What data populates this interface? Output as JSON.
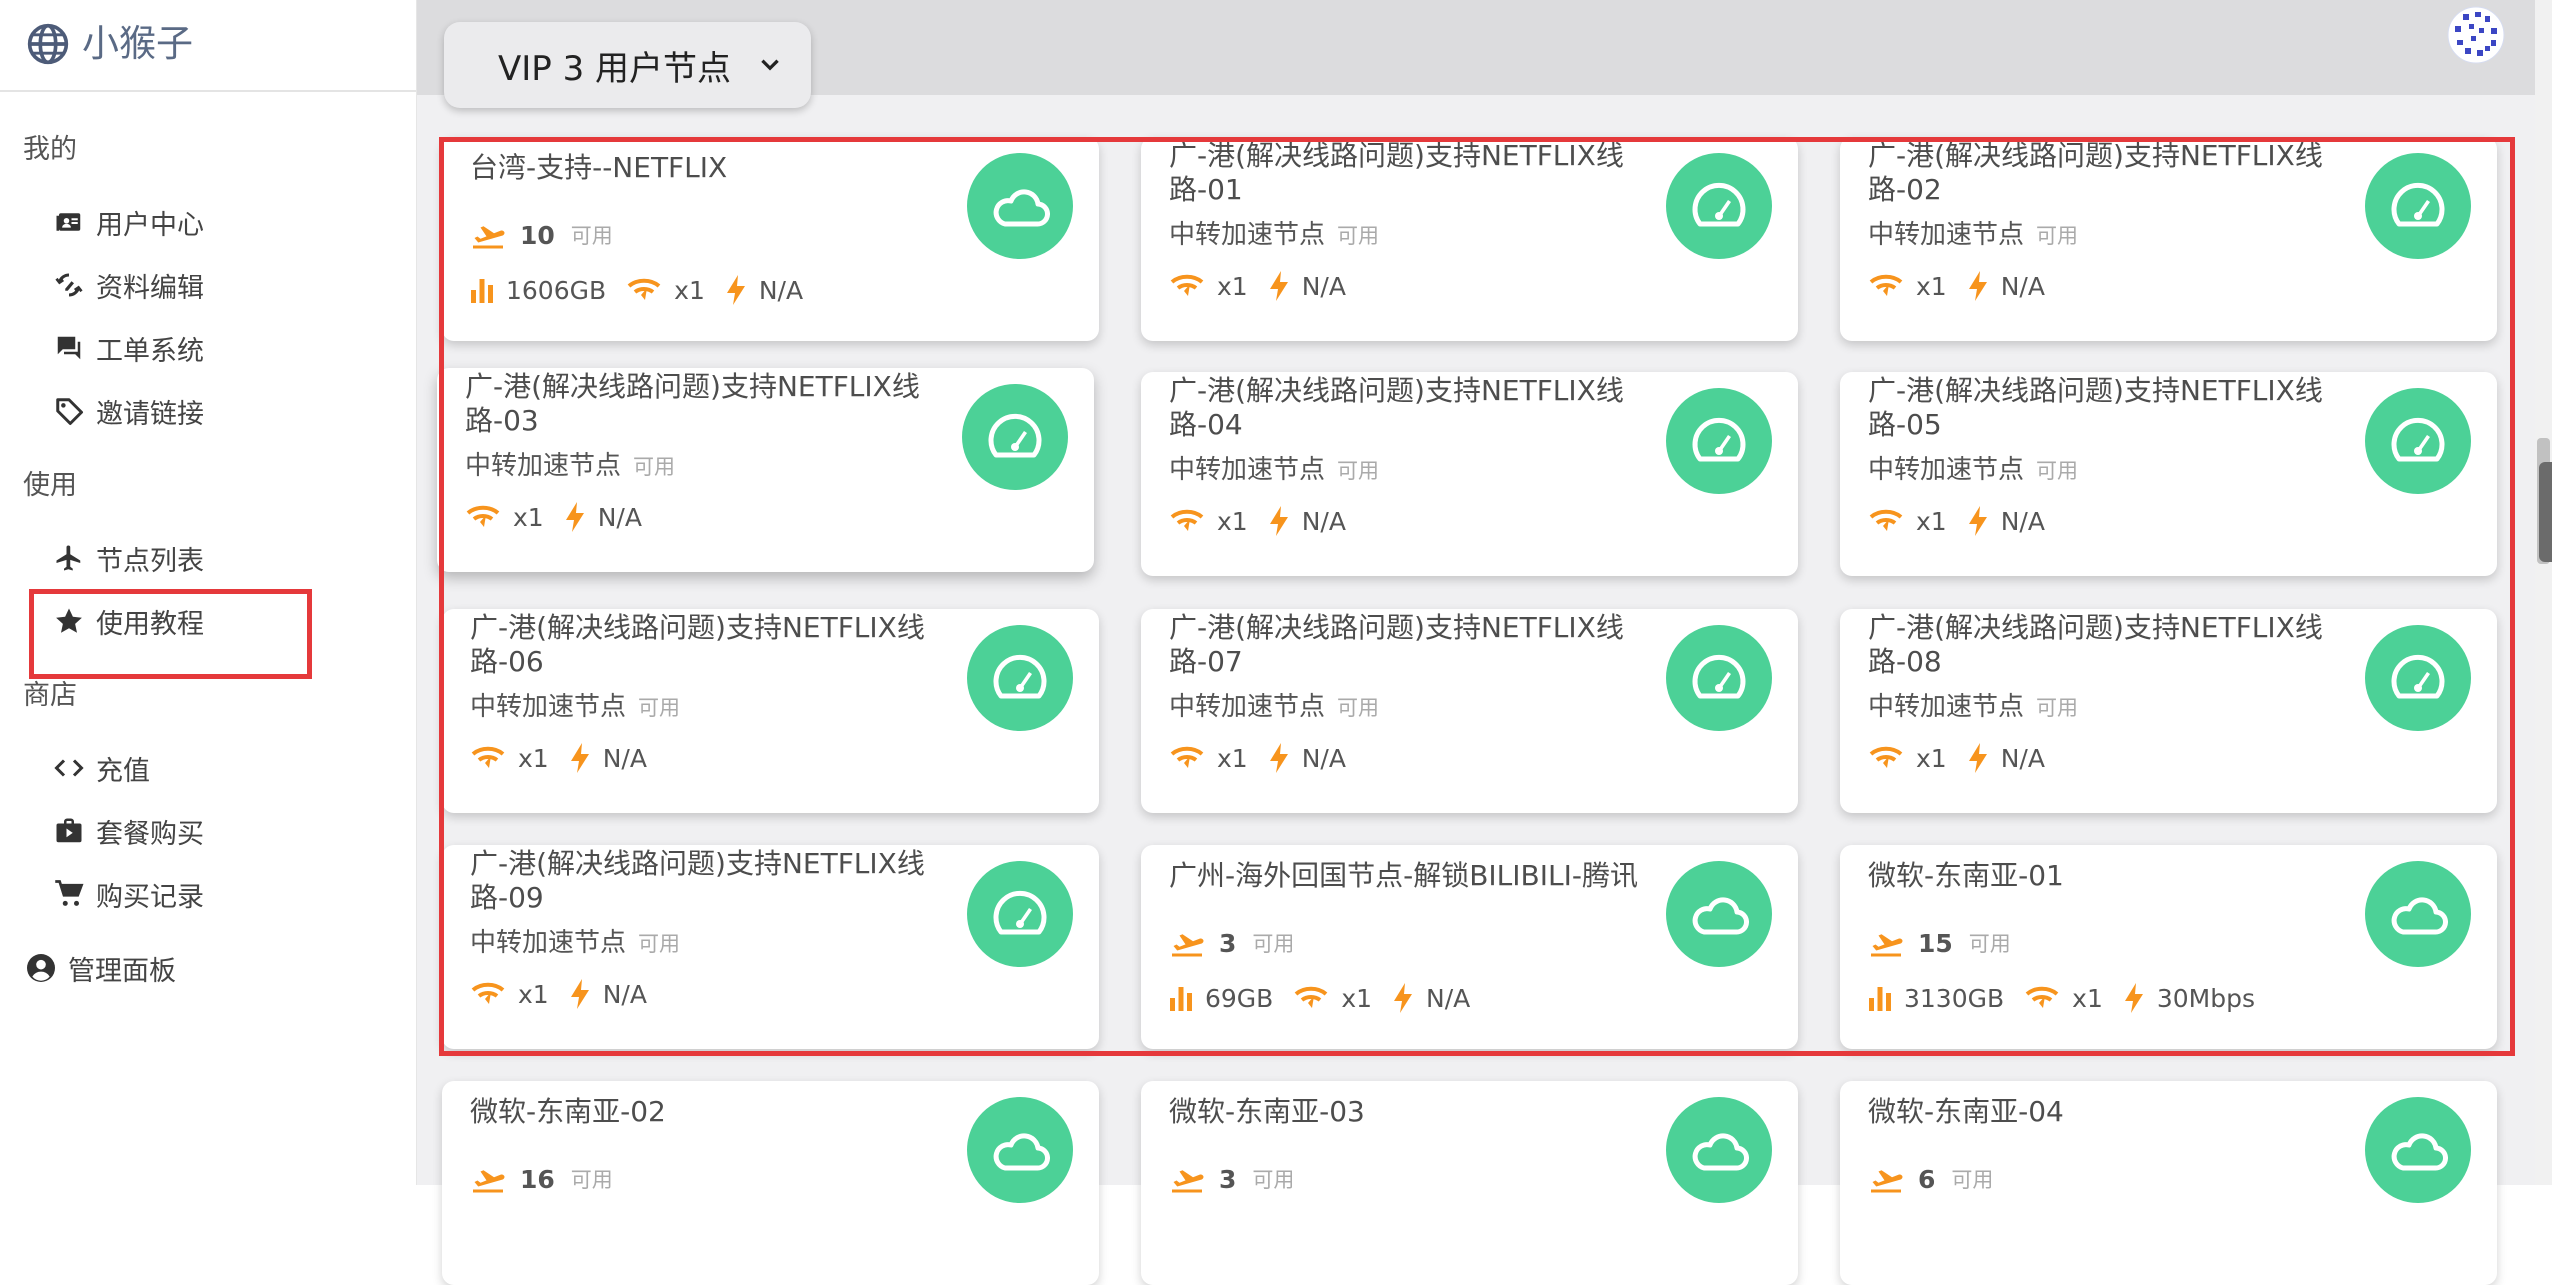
{
  "brand": {
    "name": "小猴子"
  },
  "sidebar": {
    "sections": [
      {
        "label": "我的",
        "items": [
          {
            "label": "用户中心",
            "icon": "user-center-icon"
          },
          {
            "label": "资料编辑",
            "icon": "profile-edit-icon"
          },
          {
            "label": "工单系统",
            "icon": "ticket-icon"
          },
          {
            "label": "邀请链接",
            "icon": "invite-tag-icon"
          }
        ]
      },
      {
        "label": "使用",
        "items": [
          {
            "label": "节点列表",
            "icon": "airplane-icon"
          },
          {
            "label": "使用教程",
            "icon": "star-icon"
          }
        ]
      },
      {
        "label": "商店",
        "items": [
          {
            "label": "充值",
            "icon": "code-icon"
          },
          {
            "label": "套餐购买",
            "icon": "shopping-bag-icon"
          },
          {
            "label": "购买记录",
            "icon": "cart-icon"
          }
        ]
      }
    ],
    "admin": {
      "label": "管理面板",
      "icon": "account-circle-icon"
    }
  },
  "header": {
    "group_select": "VIP 3 用户节点"
  },
  "colors": {
    "accent_green": "#4cd197",
    "icon_orange": "#f7941d",
    "highlight_red": "#e5393b"
  },
  "cards": [
    {
      "title": "台湾-支持--NETFLIX",
      "type": "direct",
      "online": "10",
      "avail": "可用",
      "traffic": "1606GB",
      "rate": "x1",
      "speed": "N/A",
      "icon": "cloud-icon"
    },
    {
      "title": "广-港(解决线路问题)支持NETFLIX线路-01",
      "type": "relay",
      "sub": "中转加速节点",
      "avail": "可用",
      "rate": "x1",
      "speed": "N/A",
      "icon": "speedometer-icon"
    },
    {
      "title": "广-港(解决线路问题)支持NETFLIX线路-02",
      "type": "relay",
      "sub": "中转加速节点",
      "avail": "可用",
      "rate": "x1",
      "speed": "N/A",
      "icon": "speedometer-icon"
    },
    {
      "title": "广-港(解决线路问题)支持NETFLIX线路-03",
      "type": "relay",
      "sub": "中转加速节点",
      "avail": "可用",
      "rate": "x1",
      "speed": "N/A",
      "icon": "speedometer-icon"
    },
    {
      "title": "广-港(解决线路问题)支持NETFLIX线路-04",
      "type": "relay",
      "sub": "中转加速节点",
      "avail": "可用",
      "rate": "x1",
      "speed": "N/A",
      "icon": "speedometer-icon"
    },
    {
      "title": "广-港(解决线路问题)支持NETFLIX线路-05",
      "type": "relay",
      "sub": "中转加速节点",
      "avail": "可用",
      "rate": "x1",
      "speed": "N/A",
      "icon": "speedometer-icon"
    },
    {
      "title": "广-港(解决线路问题)支持NETFLIX线路-06",
      "type": "relay",
      "sub": "中转加速节点",
      "avail": "可用",
      "rate": "x1",
      "speed": "N/A",
      "icon": "speedometer-icon"
    },
    {
      "title": "广-港(解决线路问题)支持NETFLIX线路-07",
      "type": "relay",
      "sub": "中转加速节点",
      "avail": "可用",
      "rate": "x1",
      "speed": "N/A",
      "icon": "speedometer-icon"
    },
    {
      "title": "广-港(解决线路问题)支持NETFLIX线路-08",
      "type": "relay",
      "sub": "中转加速节点",
      "avail": "可用",
      "rate": "x1",
      "speed": "N/A",
      "icon": "speedometer-icon"
    },
    {
      "title": "广-港(解决线路问题)支持NETFLIX线路-09",
      "type": "relay",
      "sub": "中转加速节点",
      "avail": "可用",
      "rate": "x1",
      "speed": "N/A",
      "icon": "speedometer-icon"
    },
    {
      "title": "广州-海外回国节点-解锁BILIBILI-腾讯",
      "type": "direct",
      "online": "3",
      "avail": "可用",
      "traffic": "69GB",
      "rate": "x1",
      "speed": "N/A",
      "icon": "cloud-icon"
    },
    {
      "title": "微软-东南亚-01",
      "type": "direct",
      "online": "15",
      "avail": "可用",
      "traffic": "3130GB",
      "rate": "x1",
      "speed": "30Mbps",
      "icon": "cloud-icon"
    },
    {
      "title": "微软-东南亚-02",
      "type": "direct",
      "online": "16",
      "avail": "可用",
      "traffic": "",
      "rate": "",
      "speed": "",
      "icon": "cloud-icon"
    },
    {
      "title": "微软-东南亚-03",
      "type": "direct",
      "online": "3",
      "avail": "可用",
      "traffic": "",
      "rate": "",
      "speed": "",
      "icon": "cloud-icon"
    },
    {
      "title": "微软-东南亚-04",
      "type": "direct",
      "online": "6",
      "avail": "可用",
      "traffic": "",
      "rate": "",
      "speed": "",
      "icon": "cloud-icon"
    }
  ]
}
